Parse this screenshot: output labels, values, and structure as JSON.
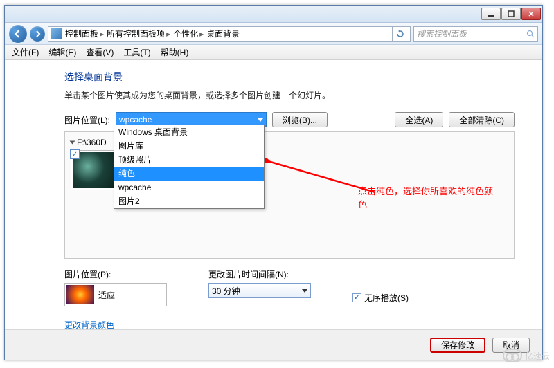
{
  "titlebar": {
    "min": "min",
    "max": "max",
    "close": "close"
  },
  "nav": {
    "crumbs": [
      "控制面板",
      "所有控制面板项",
      "个性化",
      "桌面背景"
    ],
    "search_placeholder": "搜索控制面板"
  },
  "menu": {
    "file": "文件(F)",
    "edit": "编辑(E)",
    "view": "查看(V)",
    "tools": "工具(T)",
    "help": "帮助(H)"
  },
  "page": {
    "heading": "选择桌面背景",
    "desc": "单击某个图片使其成为您的桌面背景，或选择多个图片创建一个幻灯片。",
    "loc_label": "图片位置(L):",
    "loc_value": "wpcache",
    "browse": "浏览(B)...",
    "select_all": "全选(A)",
    "clear_all": "全部清除(C)",
    "group": "F:\\360D",
    "dropdown": [
      "Windows 桌面背景",
      "图片库",
      "顶级照片",
      "纯色",
      "wpcache",
      "图片2"
    ],
    "pos_label": "图片位置(P):",
    "fit_value": "适应",
    "interval_label": "更改图片时间间隔(N):",
    "interval_value": "30 分钟",
    "shuffle": "无序播放(S)",
    "change_color": "更改背景颜色",
    "save": "保存修改",
    "cancel": "取消"
  },
  "annotation": "点击纯色，选择你所喜欢的纯色颜色",
  "watermark": "亿速云"
}
